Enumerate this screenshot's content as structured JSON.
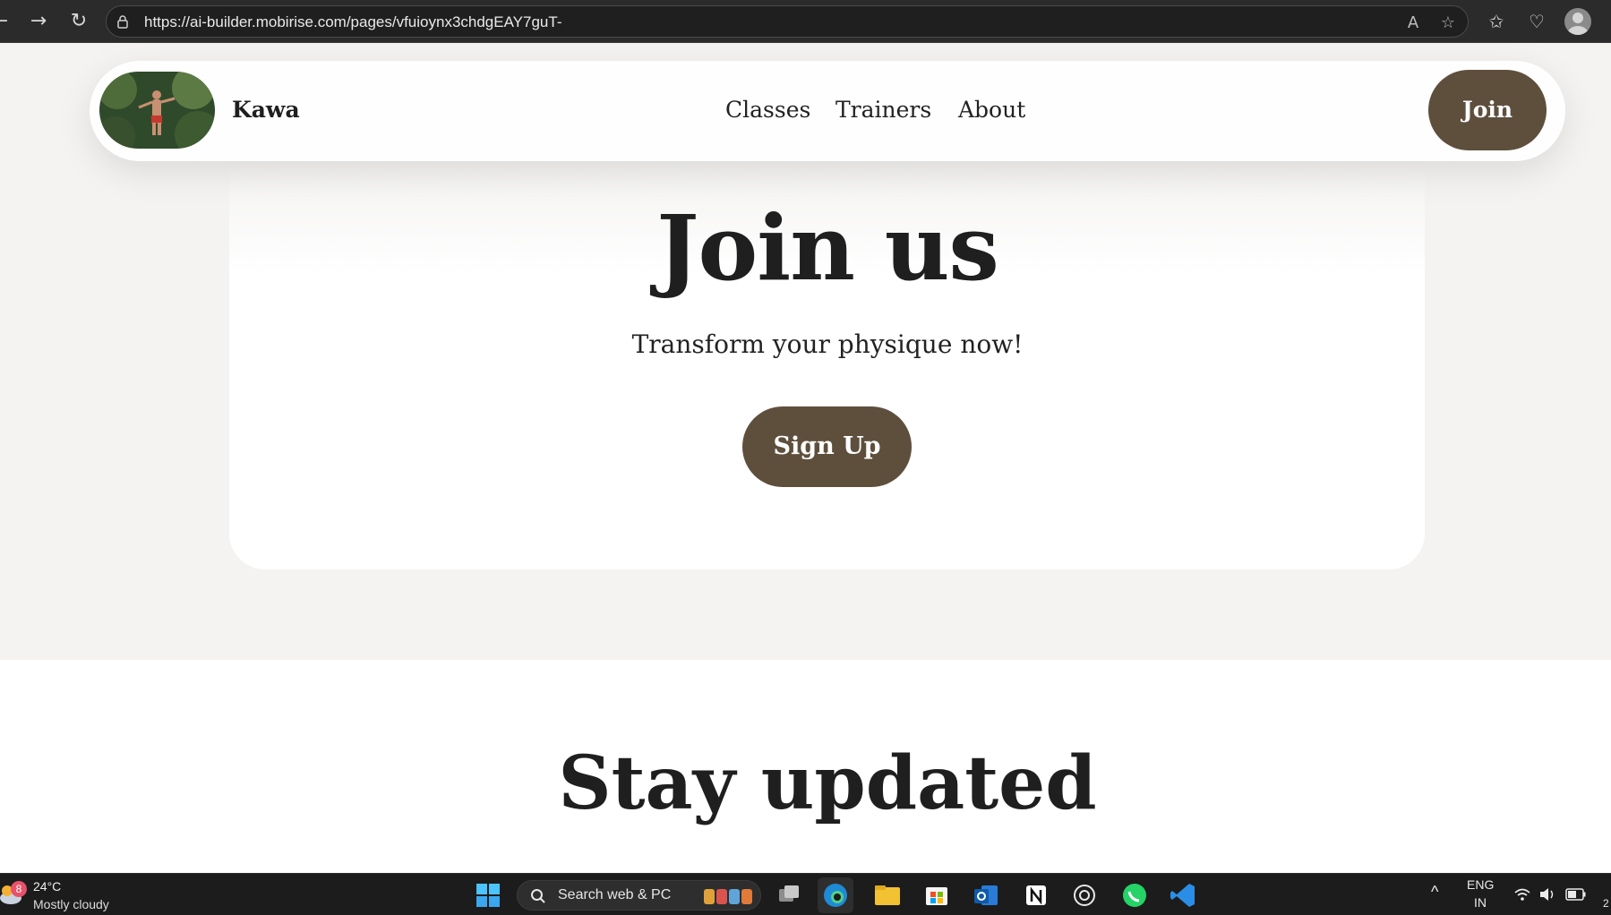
{
  "browser": {
    "url": "https://ai-builder.mobirise.com/pages/vfuioynx3chdgEAY7guT-",
    "back_icon": "back-arrow-icon",
    "forward_icon": "forward-arrow-icon",
    "refresh_icon": "refresh-icon"
  },
  "navbar": {
    "brand": "Kawa",
    "links": [
      "Classes",
      "Trainers",
      "About"
    ],
    "join_label": "Join"
  },
  "hero": {
    "title": "Join us",
    "subtitle": "Transform your physique now!",
    "cta_label": "Sign Up"
  },
  "newsletter": {
    "title": "Stay updated"
  },
  "taskbar": {
    "weather_badge": "8",
    "temperature": "24°C",
    "weather": "Mostly cloudy",
    "search_placeholder": "Search web & PC",
    "lang_line1": "ENG",
    "lang_line2": "IN",
    "clock_fragment": "2"
  },
  "colors": {
    "accent_brown": "#5e4f3d",
    "page_bg": "#f4f3f1",
    "text_dark": "#1f1f1f"
  }
}
